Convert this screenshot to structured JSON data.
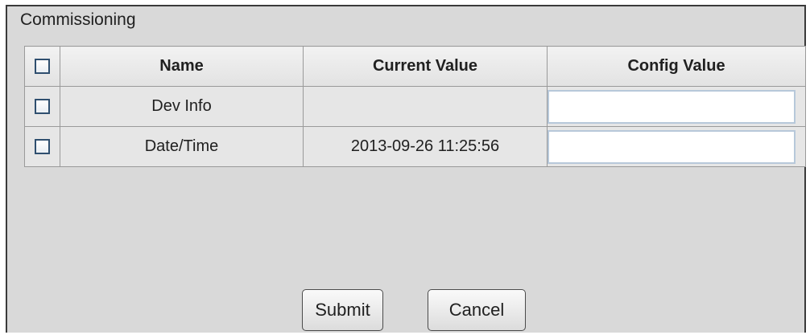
{
  "panel": {
    "title": "Commissioning"
  },
  "table": {
    "headers": {
      "name": "Name",
      "current_value": "Current Value",
      "config_value": "Config Value"
    },
    "rows": [
      {
        "name": "Dev Info",
        "current_value": "",
        "config_value": "",
        "checked": false
      },
      {
        "name": "Date/Time",
        "current_value": "2013-09-26 11:25:56",
        "config_value": "",
        "checked": false
      }
    ],
    "select_all_checked": false
  },
  "buttons": {
    "submit_label": "Submit",
    "cancel_label": "Cancel"
  }
}
